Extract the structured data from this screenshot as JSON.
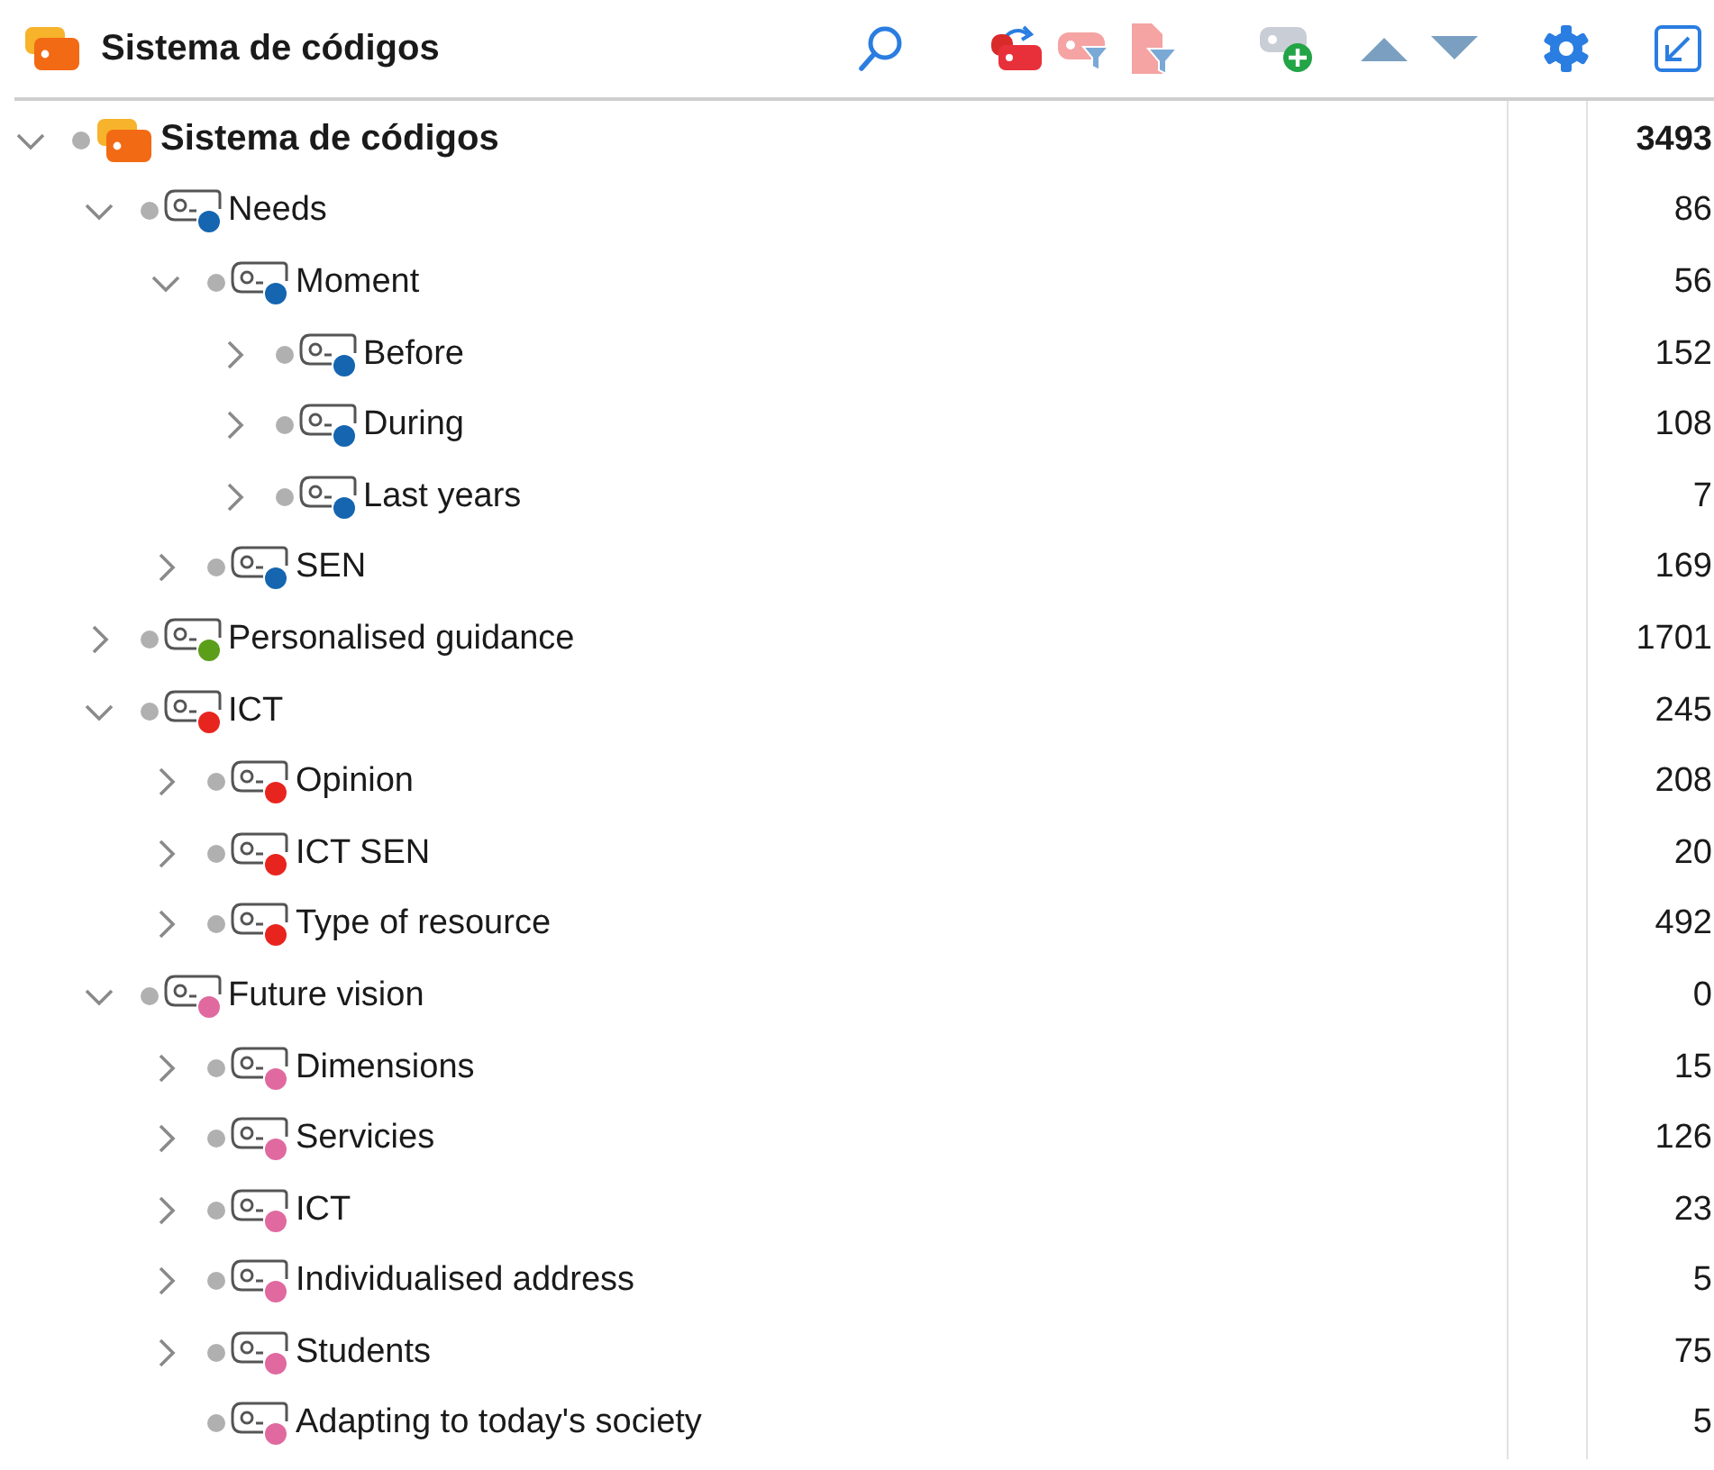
{
  "header": {
    "title": "Sistema de códigos"
  },
  "tree": [
    {
      "label": "Sistema de códigos",
      "count": "3493",
      "kind": "root",
      "expandable": true,
      "expanded": true,
      "children": [
        {
          "label": "Needs",
          "count": "86",
          "kind": "code",
          "color": "#1565b0",
          "expandable": true,
          "expanded": true,
          "children": [
            {
              "label": "Moment",
              "count": "56",
              "kind": "code",
              "color": "#1565b0",
              "expandable": true,
              "expanded": true,
              "children": [
                {
                  "label": "Before",
                  "count": "152",
                  "kind": "code",
                  "color": "#1565b0",
                  "expandable": true,
                  "expanded": false
                },
                {
                  "label": "During",
                  "count": "108",
                  "kind": "code",
                  "color": "#1565b0",
                  "expandable": true,
                  "expanded": false
                },
                {
                  "label": "Last years",
                  "count": "7",
                  "kind": "code",
                  "color": "#1565b0",
                  "expandable": true,
                  "expanded": false
                }
              ]
            },
            {
              "label": "SEN",
              "count": "169",
              "kind": "code",
              "color": "#1565b0",
              "expandable": true,
              "expanded": false
            }
          ]
        },
        {
          "label": "Personalised guidance",
          "count": "1701",
          "kind": "code",
          "color": "#5a9e1a",
          "expandable": true,
          "expanded": false
        },
        {
          "label": "ICT",
          "count": "245",
          "kind": "code",
          "color": "#e8241f",
          "expandable": true,
          "expanded": true,
          "children": [
            {
              "label": "Opinion",
              "count": "208",
              "kind": "code",
              "color": "#e8241f",
              "expandable": true,
              "expanded": false
            },
            {
              "label": "ICT SEN",
              "count": "20",
              "kind": "code",
              "color": "#e8241f",
              "expandable": true,
              "expanded": false
            },
            {
              "label": "Type of resource",
              "count": "492",
              "kind": "code",
              "color": "#e8241f",
              "expandable": true,
              "expanded": false
            }
          ]
        },
        {
          "label": "Future vision",
          "count": "0",
          "kind": "code",
          "color": "#e06a9f",
          "expandable": true,
          "expanded": true,
          "children": [
            {
              "label": "Dimensions",
              "count": "15",
              "kind": "code",
              "color": "#e06a9f",
              "expandable": true,
              "expanded": false
            },
            {
              "label": "Servicies",
              "count": "126",
              "kind": "code",
              "color": "#e06a9f",
              "expandable": true,
              "expanded": false
            },
            {
              "label": "ICT",
              "count": "23",
              "kind": "code",
              "color": "#e06a9f",
              "expandable": true,
              "expanded": false
            },
            {
              "label": "Individualised address",
              "count": "5",
              "kind": "code",
              "color": "#e06a9f",
              "expandable": true,
              "expanded": false
            },
            {
              "label": "Students",
              "count": "75",
              "kind": "code",
              "color": "#e06a9f",
              "expandable": true,
              "expanded": false
            },
            {
              "label": "Adapting to today's society",
              "count": "5",
              "kind": "code",
              "color": "#e06a9f",
              "expandable": false
            }
          ]
        }
      ]
    }
  ]
}
